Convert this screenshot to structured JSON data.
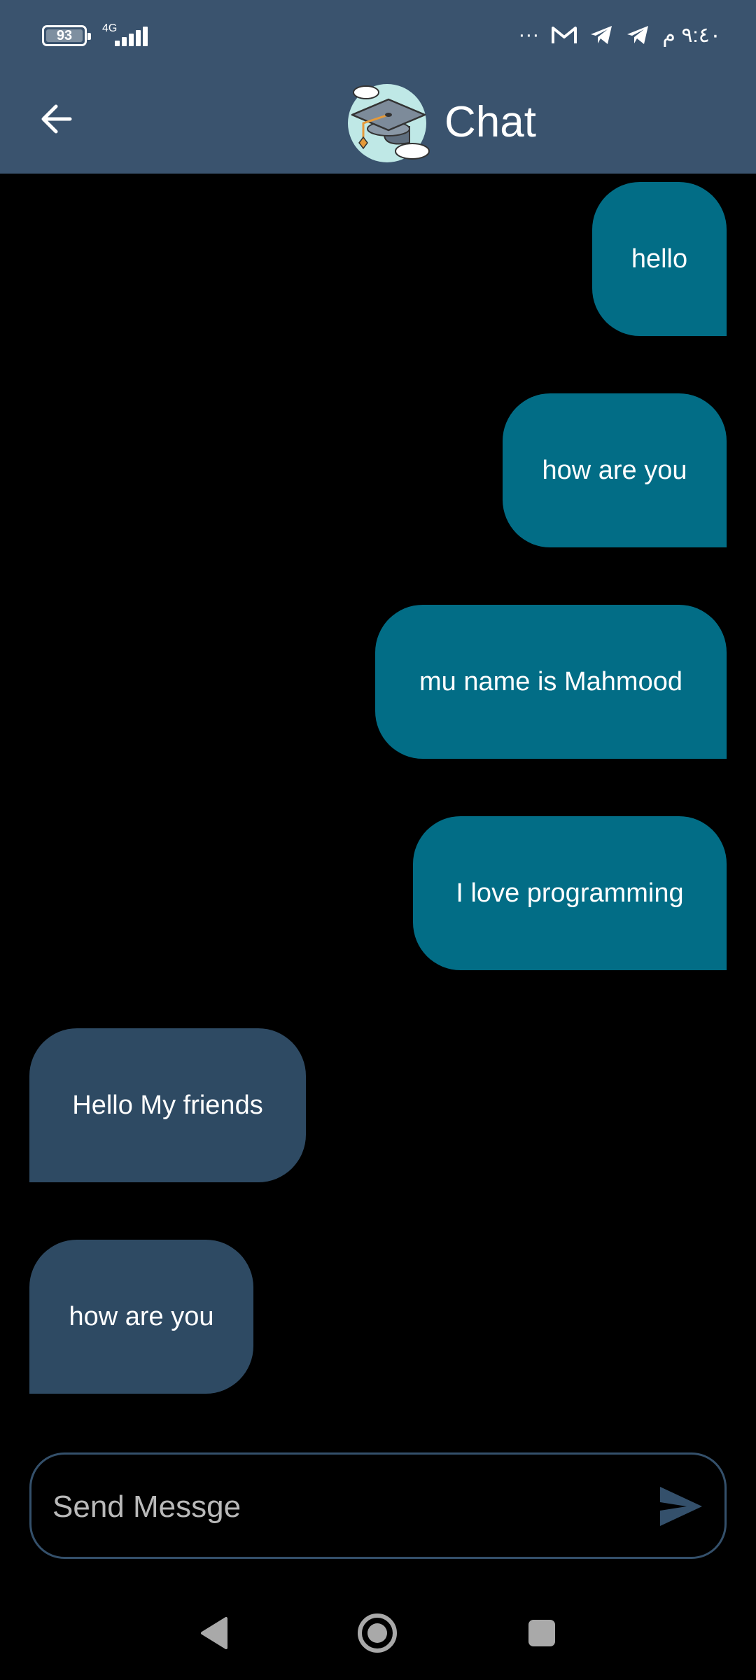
{
  "status_bar": {
    "battery": "93",
    "network": "4G",
    "overflow": "···",
    "time": "٩:٤٠ م"
  },
  "header": {
    "title": "Chat",
    "logo_icon": "graduation-cap-cloud-logo",
    "back_icon": "arrow-left-icon"
  },
  "messages": [
    {
      "text": "hello",
      "direction": "sent"
    },
    {
      "text": "how are you",
      "direction": "sent"
    },
    {
      "text": "mu name is Mahmood",
      "direction": "sent"
    },
    {
      "text": "I love programming",
      "direction": "sent"
    },
    {
      "text": "Hello My friends",
      "direction": "received"
    },
    {
      "text": "how are you",
      "direction": "received"
    }
  ],
  "composer": {
    "placeholder": "Send Messge",
    "value": "",
    "send_icon": "send-icon"
  },
  "nav": {
    "back_icon": "triangle-back-icon",
    "home_icon": "circle-home-icon",
    "recents_icon": "square-recents-icon"
  },
  "colors": {
    "app_bar": "#3a536e",
    "sent_bubble": "#026d86",
    "received_bubble": "#2e4a63",
    "background": "#000000"
  }
}
